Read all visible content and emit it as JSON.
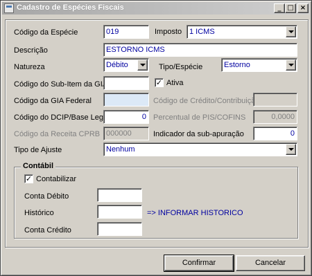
{
  "window": {
    "title": "Cadastro de Espécies Fiscais",
    "buttons": {
      "minimize": "_",
      "maximize": "□",
      "close": "×"
    }
  },
  "form": {
    "codigo_especie": {
      "label": "Código da Espécie",
      "value": "019"
    },
    "imposto": {
      "label": "Imposto",
      "value": "1 ICMS"
    },
    "descricao": {
      "label": "Descrição",
      "value": "ESTORNO ICMS"
    },
    "natureza": {
      "label": "Natureza",
      "value": "Débito"
    },
    "tipo_especie": {
      "label": "Tipo/Espécie",
      "value": "Estorno"
    },
    "sub_item_gia": {
      "label": "Código do Sub-Item da GIA",
      "value": ""
    },
    "ativa": {
      "label": "Ativa",
      "checked": true,
      "mark": "✓"
    },
    "gia_federal": {
      "label": "Código da GIA Federal",
      "value": ""
    },
    "codigo_credito": {
      "label": "Código de Crédito/Contribuição",
      "value": ""
    },
    "dcip": {
      "label": "Código do DCIP/Base Legal",
      "value": "0"
    },
    "percentual_pis": {
      "label": "Percentual de PIS/COFINS",
      "value": "0,0000"
    },
    "receita_cprb": {
      "label": "Código da Receita CPRB",
      "value": "000000"
    },
    "indicador_sub_apuracao": {
      "label": "Indicador da sub-apuração",
      "value": "0"
    },
    "tipo_ajuste": {
      "label": "Tipo de Ajuste",
      "value": "Nenhum"
    }
  },
  "contabil": {
    "legend": "Contábil",
    "contabilizar": {
      "label": "Contabilizar",
      "checked": true,
      "mark": "✓"
    },
    "conta_debito": {
      "label": "Conta Débito",
      "value": ""
    },
    "historico": {
      "label": "Histórico",
      "value": "",
      "hint": "=> INFORMAR HISTORICO"
    },
    "conta_credito": {
      "label": "Conta Crédito",
      "value": ""
    }
  },
  "actions": {
    "confirmar": "Confirmar",
    "cancelar": "Cancelar"
  }
}
